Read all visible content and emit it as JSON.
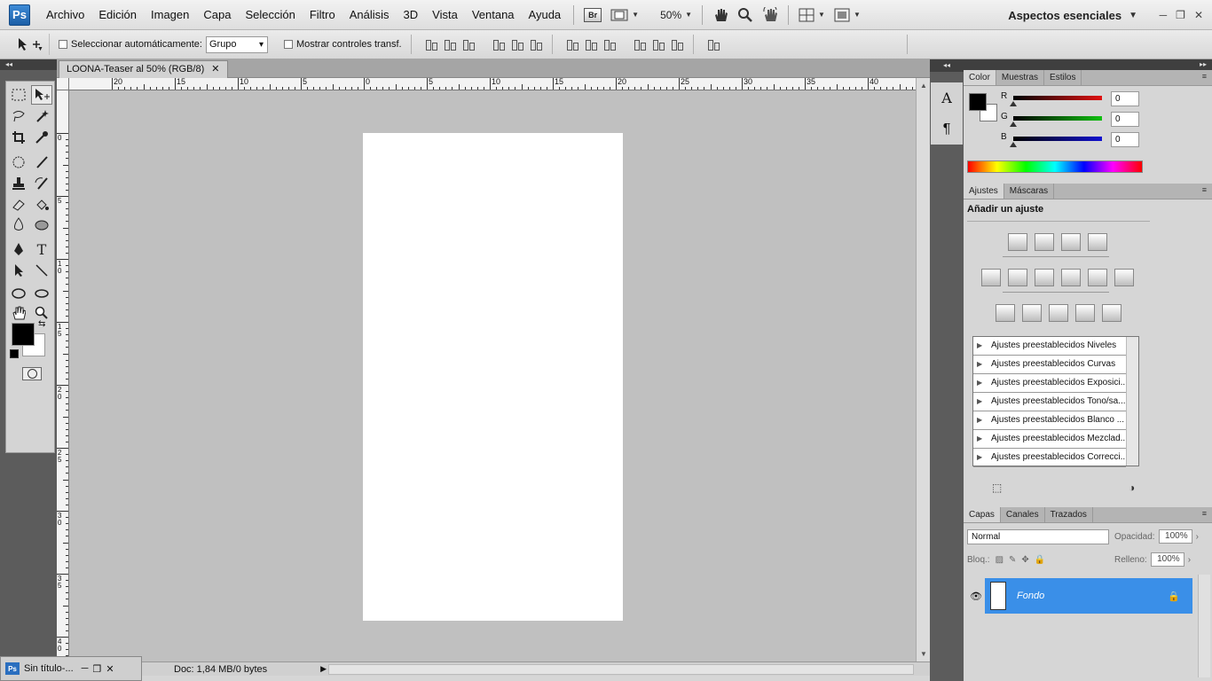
{
  "app": {
    "logo": "Ps"
  },
  "menu": [
    "Archivo",
    "Edición",
    "Imagen",
    "Capa",
    "Selección",
    "Filtro",
    "Análisis",
    "3D",
    "Vista",
    "Ventana",
    "Ayuda"
  ],
  "menubar": {
    "bridge": "Br",
    "zoom": "50%",
    "workspace": "Aspectos esenciales"
  },
  "options": {
    "auto_select": "Seleccionar automáticamente:",
    "auto_select_value": "Grupo",
    "show_transform": "Mostrar controles transf."
  },
  "document": {
    "tab_title": "LOONA-Teaser al 50% (RGB/8)",
    "status": "Doc: 1,84 MB/0 bytes",
    "minimized_title": "Sin título-..."
  },
  "rulers": {
    "h_labels": [
      "20",
      "15",
      "10",
      "5",
      "0",
      "5",
      "10",
      "15",
      "20",
      "25",
      "30",
      "35",
      "40"
    ],
    "v_labels": [
      "0",
      "5",
      "10",
      "15",
      "20",
      "25",
      "30",
      "35",
      "40"
    ]
  },
  "color_panel": {
    "tabs": [
      "Color",
      "Muestras",
      "Estilos"
    ],
    "r_label": "R",
    "g_label": "G",
    "b_label": "B",
    "r": "0",
    "g": "0",
    "b": "0",
    "r_color": "#e01010",
    "g_color": "#10c010",
    "b_color": "#1010d0"
  },
  "adjustments": {
    "tabs": [
      "Ajustes",
      "Máscaras"
    ],
    "title": "Añadir un ajuste",
    "presets": [
      "Ajustes preestablecidos Niveles",
      "Ajustes preestablecidos Curvas",
      "Ajustes preestablecidos Exposici...",
      "Ajustes preestablecidos Tono/sa...",
      "Ajustes preestablecidos Blanco ...",
      "Ajustes preestablecidos Mezclad...",
      "Ajustes preestablecidos Correcci..."
    ]
  },
  "layers": {
    "tabs": [
      "Capas",
      "Canales",
      "Trazados"
    ],
    "blend_mode": "Normal",
    "opacity_label": "Opacidad:",
    "opacity": "100%",
    "lock_label": "Bloq.:",
    "fill_label": "Relleno:",
    "fill": "100%",
    "layer_name": "Fondo",
    "selection_color": "#3a8fe8"
  }
}
